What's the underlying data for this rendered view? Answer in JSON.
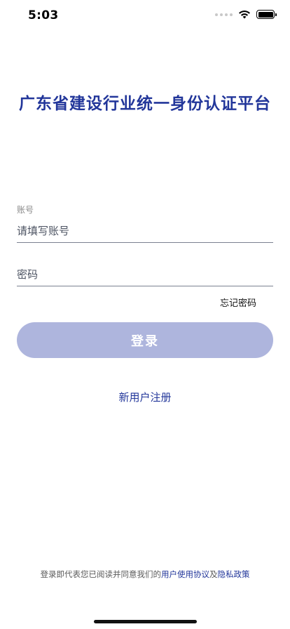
{
  "status_bar": {
    "time": "5:03",
    "icons": [
      "signal-icon",
      "wifi-icon",
      "battery-icon"
    ]
  },
  "app_title": "广东省建设行业统一身份认证平台",
  "form": {
    "account_label": "账号",
    "account_placeholder": "请填写账号",
    "password_placeholder": "密码",
    "forgot_password": "忘记密码",
    "login_button": "登录"
  },
  "register_link": "新用户注册",
  "agreement": {
    "prefix": "登录即代表您已阅读并同意我们的",
    "user_agreement": "用户使用协议",
    "conjunction": "及",
    "privacy_policy": "隐私政策"
  },
  "colors": {
    "brand": "#22369a",
    "button_disabled": "#aeb5dd",
    "underline": "#7b8190"
  }
}
